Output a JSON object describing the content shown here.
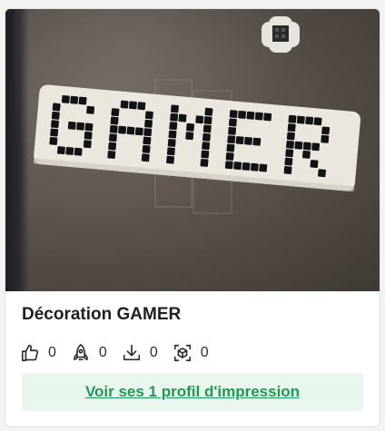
{
  "card": {
    "title": "Décoration GAMER",
    "image": {
      "subject": "3D printed pixel-style sign",
      "sign_text": "GAMER"
    },
    "stats": [
      {
        "icon": "thumbs-up-icon",
        "value": "0"
      },
      {
        "icon": "rocket-icon",
        "value": "0"
      },
      {
        "icon": "download-icon",
        "value": "0"
      },
      {
        "icon": "cube-scan-icon",
        "value": "0"
      }
    ],
    "cta_label": "Voir ses 1 profil d'impression",
    "colors": {
      "cta_background": "#e9f6ee",
      "cta_text": "#1f9a55",
      "title": "#1f1f1f"
    }
  }
}
